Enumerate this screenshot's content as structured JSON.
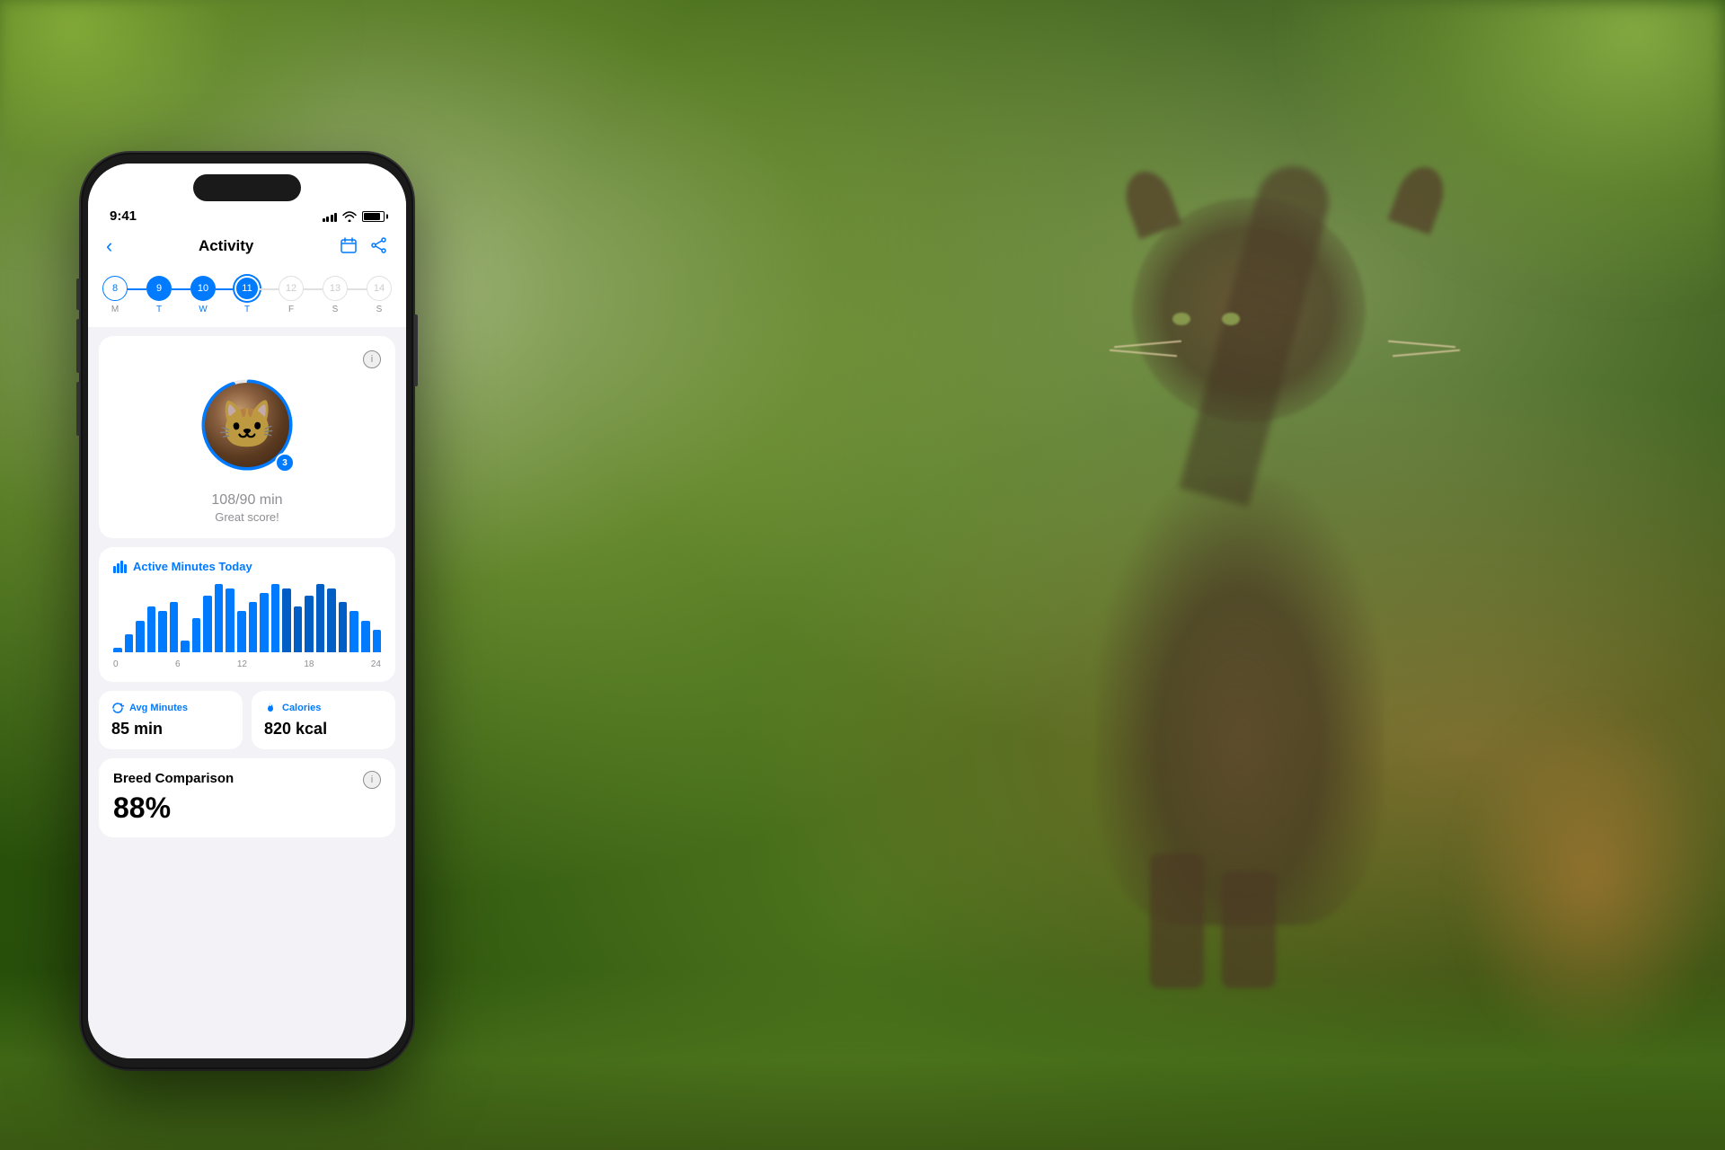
{
  "background": {
    "description": "Outdoor blurred background with cat and foliage"
  },
  "phone": {
    "statusBar": {
      "time": "9:41",
      "signal": [
        3,
        4,
        5,
        6,
        7
      ],
      "wifi": true,
      "battery": 85
    },
    "header": {
      "backLabel": "‹",
      "title": "Activity",
      "calendarIcon": "📅",
      "shareIcon": "⬆"
    },
    "daySelector": {
      "days": [
        {
          "number": "8",
          "label": "M",
          "state": "past"
        },
        {
          "number": "9",
          "label": "T",
          "state": "active"
        },
        {
          "number": "10",
          "label": "W",
          "state": "active"
        },
        {
          "number": "11",
          "label": "T",
          "state": "active"
        },
        {
          "number": "12",
          "label": "F",
          "state": "inactive"
        },
        {
          "number": "13",
          "label": "S",
          "state": "inactive"
        },
        {
          "number": "14",
          "label": "S",
          "state": "inactive"
        }
      ]
    },
    "scoreCard": {
      "infoLabel": "i",
      "score": "108",
      "scoreTarget": "/90 min",
      "scoreLabel": "Great score!",
      "badge": "3"
    },
    "activityChart": {
      "title": "Active Minutes Today",
      "titleIcon": "📊",
      "bars": [
        2,
        8,
        14,
        20,
        18,
        22,
        5,
        15,
        25,
        30,
        28,
        18,
        22,
        26,
        30,
        28,
        20,
        25,
        30,
        28,
        22,
        18,
        14,
        10
      ],
      "labels": [
        "0",
        "6",
        "12",
        "18",
        "24"
      ]
    },
    "stats": {
      "avgMinutes": {
        "icon": "🔄",
        "label": "Avg Minutes",
        "value": "85 min"
      },
      "calories": {
        "icon": "🔥",
        "label": "Calories",
        "value": "820 kcal"
      }
    },
    "breedComparison": {
      "title": "Breed Comparison",
      "percentage": "88%"
    }
  }
}
